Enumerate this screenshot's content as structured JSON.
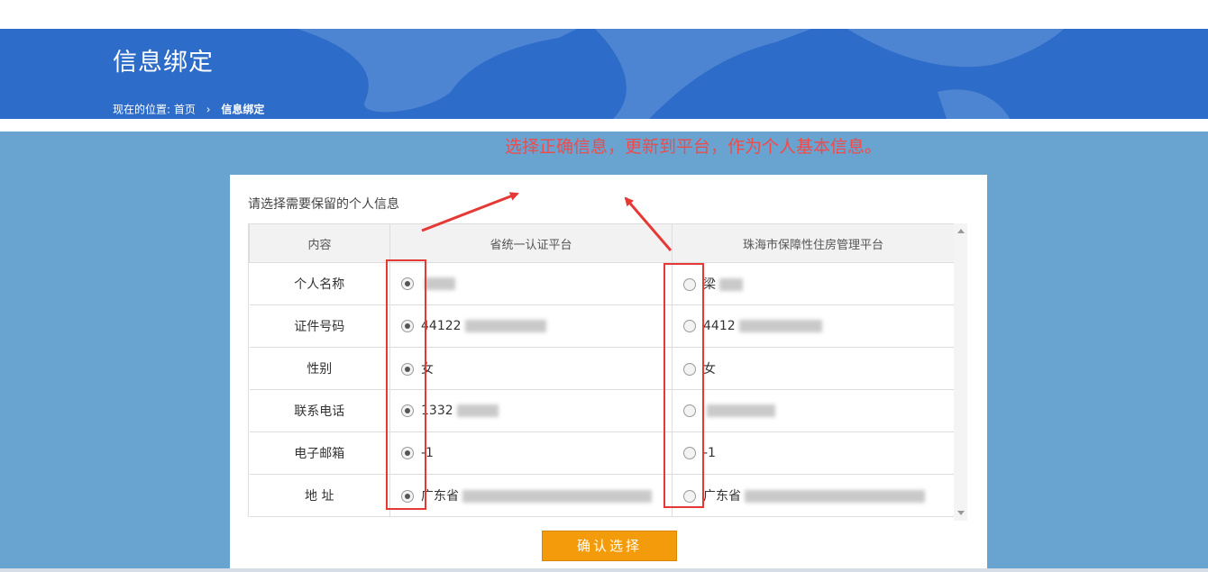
{
  "header": {
    "title": "信息绑定",
    "breadcrumb_prefix": "现在的位置:",
    "breadcrumb_home": "首页",
    "breadcrumb_sep": "›",
    "breadcrumb_current": "信息绑定"
  },
  "annotation": {
    "text": "选择正确信息，更新到平台，作为个人基本信息。",
    "color": "#f04b4b"
  },
  "panel": {
    "prompt": "请选择需要保留的个人信息",
    "columns": [
      "内容",
      "省统一认证平台",
      "珠海市保障性住房管理平台"
    ],
    "rows": [
      {
        "label": "个人名称",
        "left": "",
        "right": "梁"
      },
      {
        "label": "证件号码",
        "left": "44122",
        "right": "4412"
      },
      {
        "label": "性别",
        "left": "女",
        "right": "女"
      },
      {
        "label": "联系电话",
        "left": "1332",
        "right": ""
      },
      {
        "label": "电子邮箱",
        "left": "-1",
        "right": "-1"
      },
      {
        "label": "地 址",
        "left": "广东省",
        "right": "广东省"
      }
    ],
    "selected_column": "省统一认证平台",
    "confirm_label": "确认选择"
  },
  "colors": {
    "banner": "#2d6cc8",
    "stage": "#69a3cf",
    "button": "#f39b0a",
    "highlight": "#e53935"
  }
}
